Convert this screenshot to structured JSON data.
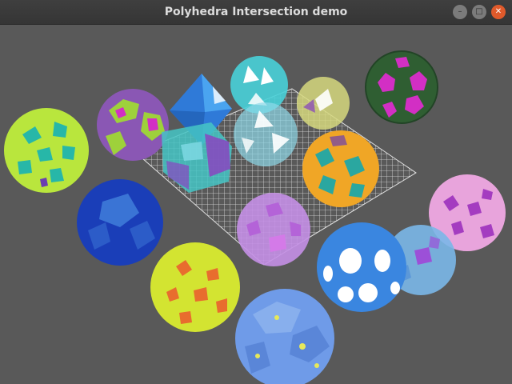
{
  "window": {
    "title": "Polyhedra Intersection demo",
    "controls": {
      "minimize_icon": "–",
      "maximize_icon": "□",
      "close_icon": "✕"
    }
  },
  "scene": {
    "background": "#595959",
    "grid_color": "#d9d9d9",
    "objects": [
      {
        "name": "yellow-green-sphere",
        "color": "#b9e63d",
        "accent": "#27b7a8"
      },
      {
        "name": "purple-green-sphere",
        "color": "#8a57b4",
        "accent": "#9ed13b"
      },
      {
        "name": "blue-octahedron",
        "color": "#2f7ad8",
        "accent": "#4aa4f0"
      },
      {
        "name": "cyan-cluster",
        "color": "#48d0d8",
        "accent": "#ffffff"
      },
      {
        "name": "pale-yellow-cluster",
        "color": "#d6d87e",
        "accent": "#8c4fb8"
      },
      {
        "name": "dark-green-sphere",
        "color": "#2f5e32",
        "accent": "#d22fc4"
      },
      {
        "name": "teal-purple-cube",
        "color": "#45c6c6",
        "accent": "#8a45c0"
      },
      {
        "name": "center-cyan-cluster",
        "color": "#8fd8e8",
        "accent": "#ffffff"
      },
      {
        "name": "orange-sphere",
        "color": "#f0a626",
        "accent": "#2aa7a0"
      },
      {
        "name": "navy-sphere",
        "color": "#1a3eb8",
        "accent": "#3e7ad8"
      },
      {
        "name": "lavender-sphere",
        "color": "#c48fe6",
        "accent": "#b463d8"
      },
      {
        "name": "pink-sphere",
        "color": "#e8a4dc",
        "accent": "#a43cc0"
      },
      {
        "name": "blue-holed-sphere",
        "color": "#3a86e0",
        "accent": "#ffffff"
      },
      {
        "name": "light-blue-sphere",
        "color": "#7ab7e8",
        "accent": "#9c50d8"
      },
      {
        "name": "yellow-sphere",
        "color": "#d3e431",
        "accent": "#e86d2e"
      },
      {
        "name": "periwinkle-sphere",
        "color": "#6f9be8",
        "accent": "#e6e85a"
      }
    ]
  }
}
